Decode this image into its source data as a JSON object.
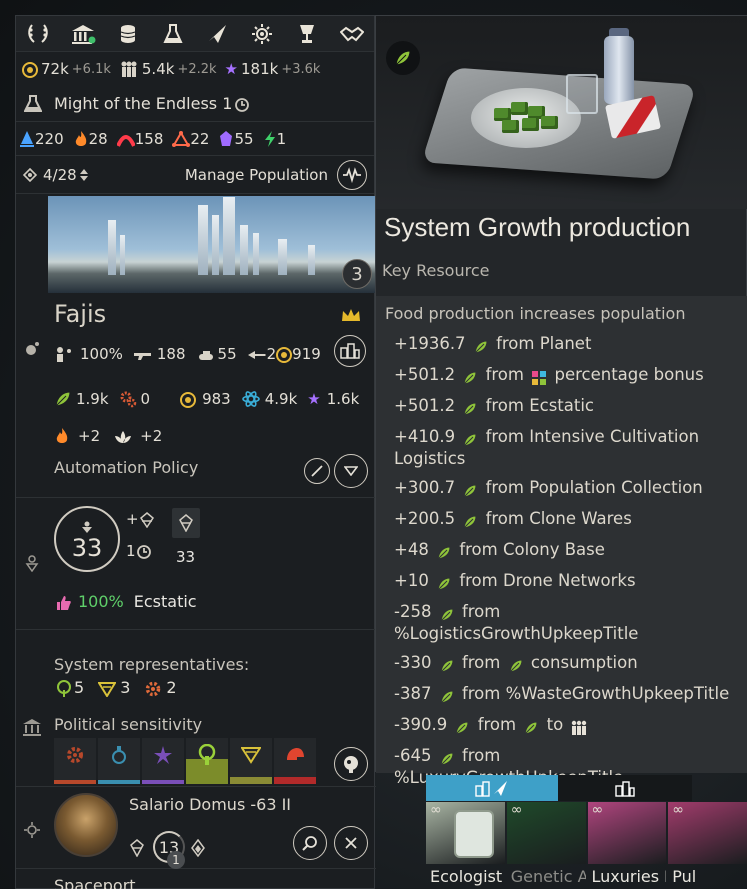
{
  "top_nav": [
    {
      "icon": "laurels-icon"
    },
    {
      "icon": "institution-icon"
    },
    {
      "icon": "coins-icon"
    },
    {
      "icon": "flask-icon"
    },
    {
      "icon": "ship-icon"
    },
    {
      "icon": "settings-sun-icon"
    },
    {
      "icon": "trophy-icon"
    },
    {
      "icon": "handshake-icon"
    }
  ],
  "resources": {
    "dust": "72k",
    "dust_delta": "+6.1k",
    "population": "5.4k",
    "population_delta": "+2.2k",
    "influence": "181k",
    "influence_delta": "+3.6k"
  },
  "might": {
    "label": "Might of the Endless 1"
  },
  "strategic": [
    {
      "icon": "water-drop-icon",
      "value": "220",
      "color": "#4aa3ff"
    },
    {
      "icon": "flame-icon",
      "value": "28",
      "color": "#ff8a2a"
    },
    {
      "icon": "arc-icon",
      "value": "158",
      "color": "#ff3b4a"
    },
    {
      "icon": "triangle-nodes-icon",
      "value": "22",
      "color": "#ff6a4a"
    },
    {
      "icon": "crystal-icon",
      "value": "55",
      "color": "#a06bff"
    },
    {
      "icon": "bolt-icon",
      "value": "1",
      "color": "#3fd16a"
    }
  ],
  "population_bar": {
    "count": "4/28",
    "manage_label": "Manage Population"
  },
  "planet": {
    "level": "3",
    "name": "Fajis",
    "approval_pct": "100%",
    "military": "188",
    "ships": "55",
    "manpower": "2",
    "dust": "919",
    "food": "1.9k",
    "industry": "0",
    "gold": "983",
    "science": "4.9k",
    "influence": "1.6k",
    "fire": "+2",
    "lotus": "+2",
    "automation_label": "Automation Policy"
  },
  "pop": {
    "total": "33",
    "plus_label": "+",
    "growth": "1",
    "faction_count": "33",
    "approval_pct": "100%",
    "approval_label": "Ecstatic"
  },
  "political": {
    "representatives_label": "System representatives:",
    "reps": [
      {
        "icon": "tree-icon",
        "value": "5"
      },
      {
        "icon": "triangle-icon",
        "value": "3"
      },
      {
        "icon": "gear-icon",
        "value": "2"
      }
    ],
    "sensitivity_label": "Political sensitivity",
    "bars": [
      {
        "icon": "gear-icon",
        "color": "#b7482b",
        "level": 0.0
      },
      {
        "icon": "flask-icon",
        "color": "#3a8fb0",
        "level": 0.0
      },
      {
        "icon": "flower-icon",
        "color": "#7a4fb8",
        "level": 0.0
      },
      {
        "icon": "tree-icon",
        "color": "#7c8c2a",
        "level": 0.55
      },
      {
        "icon": "triangle-icon",
        "color": "#8a8b35",
        "level": 0.15
      },
      {
        "icon": "helmet-icon",
        "color": "#b22a2a",
        "level": 0.15
      }
    ]
  },
  "governor": {
    "name": "Salario Domus -63 II",
    "level": "13",
    "points": "1"
  },
  "spaceport_label": "Spaceport",
  "tooltip": {
    "title": "System Growth production",
    "subtitle": "Key Resource",
    "header": "Food production increases population",
    "lines": [
      {
        "value": "+1936.7",
        "text": "from Planet"
      },
      {
        "value": "+501.2",
        "text": "from",
        "extra_icon": "percentage-icon",
        "extra": "percentage bonus"
      },
      {
        "value": "+501.2",
        "text": "from Ecstatic"
      },
      {
        "value": "+410.9",
        "text": "from Intensive Cultivation",
        "text2": "Logistics"
      },
      {
        "value": "+300.7",
        "text": "from Population Collection"
      },
      {
        "value": "+200.5",
        "text": "from Clone Wares"
      },
      {
        "value": "+48",
        "text": "from Colony Base"
      },
      {
        "value": "+10",
        "text": "from Drone Networks"
      },
      {
        "value": "-258",
        "text": "from",
        "text2": "%LogisticsGrowthUpkeepTitle"
      },
      {
        "value": "-330",
        "text": "from",
        "extra_icon": "leaf-icon",
        "extra": "consumption"
      },
      {
        "value": "-387",
        "text": "from %WasteGrowthUpkeepTitle"
      },
      {
        "value": "-390.9",
        "text": "from",
        "extra_icon": "leaf-icon",
        "extra": "to",
        "tail_icon": "population-icon"
      },
      {
        "value": "-645",
        "text": "from",
        "text2": "%LuxuryGrowthUpkeepTitle"
      }
    ]
  },
  "bottom_panel": {
    "tabs": [
      {
        "icon": "build-ship-icon"
      },
      {
        "icon": "build-city-icon"
      }
    ],
    "cards": [
      {
        "label": "Ecologist .",
        "color": "#e9e7df",
        "bg": "#a8b4a3"
      },
      {
        "label": "Genetic Al.",
        "color": "#8c8c88",
        "bg": "#1f4a2a"
      },
      {
        "label": "Luxuries L.",
        "color": "#e9e7df",
        "bg": "#b0457e"
      },
      {
        "label": "Pul",
        "color": "#e9e7df",
        "bg": "#a23c6c"
      }
    ]
  }
}
